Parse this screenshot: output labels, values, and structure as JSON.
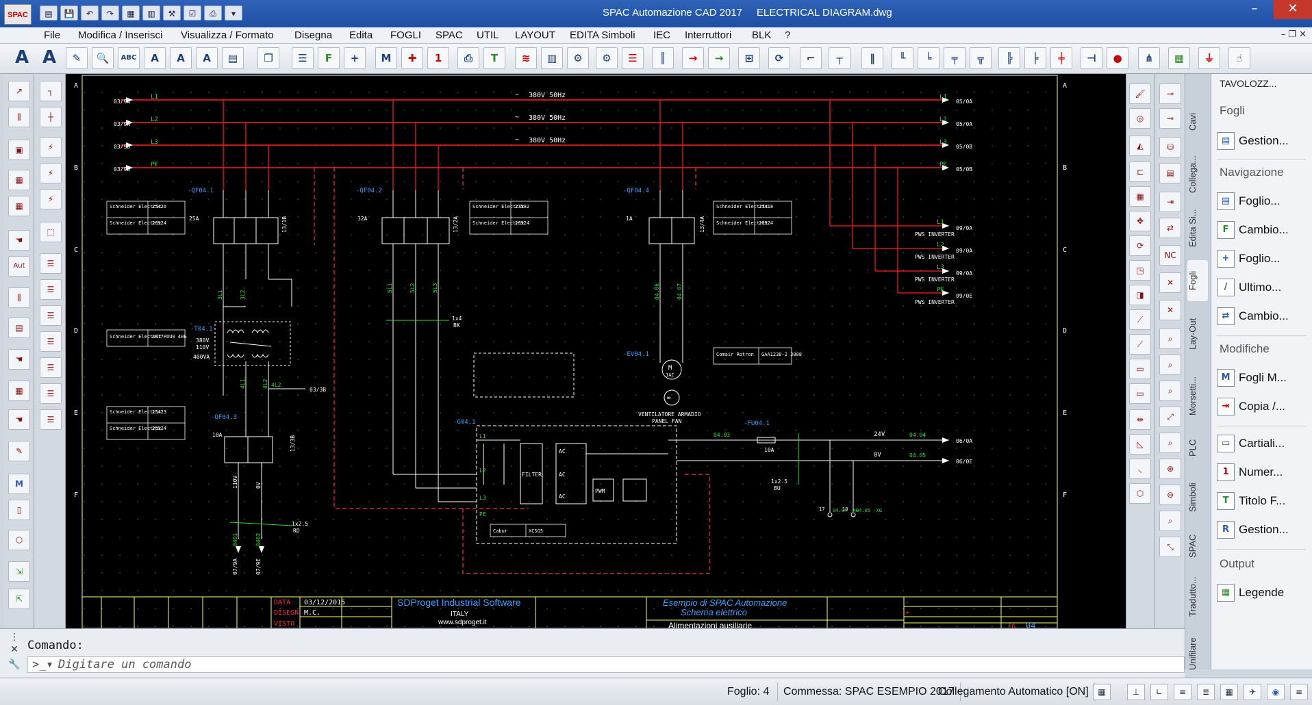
{
  "window": {
    "app_title": "SPAC Automazione CAD 2017",
    "file_title": "ELECTRICAL DIAGRAM.dwg",
    "logo": "SPAC"
  },
  "menu": [
    "File",
    "Modifica / Inserisci",
    "Visualizza / Formato",
    "Disegna",
    "Edita",
    "FOGLI",
    "SPAC",
    "UTIL",
    "LAYOUT",
    "EDITA Simboli",
    "IEC",
    "Interruttori",
    "BLK",
    "?"
  ],
  "diagram": {
    "rows": [
      "A",
      "B",
      "C",
      "D",
      "E",
      "F"
    ],
    "phases": [
      {
        "src": "03/9A",
        "name": "L1",
        "dst": "05/0A"
      },
      {
        "src": "03/9A",
        "name": "L2",
        "dst": "05/0A"
      },
      {
        "src": "03/9B",
        "name": "L3",
        "dst": "05/0B"
      },
      {
        "src": "03/9B",
        "name": "PE",
        "dst": "05/0B"
      }
    ],
    "supply_labels": [
      "380V 50Hz",
      "380V 50Hz",
      "380V 50Hz"
    ],
    "breakers": [
      {
        "tag": "-QF04.1",
        "rating": "25A",
        "ref": "13/1B"
      },
      {
        "tag": "-QF04.2",
        "rating": "32A",
        "ref": "13/2A"
      },
      {
        "tag": "-QF04.4",
        "rating": "1A",
        "ref": "13/4A"
      },
      {
        "tag": "-QF04.3",
        "rating": "10A",
        "ref": "13/3B"
      }
    ],
    "component_tables": [
      {
        "rows": [
          [
            "Schneider Electric",
            "25426"
          ],
          [
            "Schneider Electric",
            "26924"
          ]
        ]
      },
      {
        "rows": [
          [
            "Schneider Electric",
            "23592"
          ],
          [
            "Schneider Electric",
            "26924"
          ]
        ]
      },
      {
        "rows": [
          [
            "Schneider Electric",
            "25418"
          ],
          [
            "Schneider Electric",
            "26924"
          ]
        ]
      },
      {
        "rows": [
          [
            "Schneider Electric",
            "ABT7PDU0 40G"
          ]
        ]
      },
      {
        "rows": [
          [
            "Schneider Electric",
            "25423"
          ],
          [
            "Schneider Electric",
            "26924"
          ]
        ]
      },
      {
        "rows": [
          [
            "Comair Rotron",
            "GAA1238-2 3088"
          ]
        ]
      },
      {
        "rows": [
          [
            "Cabur",
            "XCSG5"
          ]
        ]
      }
    ],
    "inverter_outputs": [
      {
        "name": "L1",
        "label": "PWS INVERTER",
        "dst": "09/0A"
      },
      {
        "name": "L2",
        "label": "PWS INVERTER",
        "dst": "09/0A"
      },
      {
        "name": "L3",
        "label": "PWS INVERTER",
        "dst": "09/0A"
      },
      {
        "name": "PE",
        "label": "PWS INVERTER",
        "dst": "09/0E"
      }
    ],
    "transformer": {
      "tag": "-T04.1",
      "primary": "380V",
      "mid": "110V",
      "secondary": "400VA"
    },
    "wires": {
      "w1": "3L1",
      "w2": "3L2",
      "w3": "4L1",
      "w4": "4L2",
      "w4ref": "03/3B",
      "w5": "5L1",
      "w6": "5L2",
      "w7": "5L3",
      "w8": "04.06",
      "w9": "04.07",
      "w10": "0401",
      "w11": "0402",
      "v110": "110V",
      "v0": "0V",
      "bus1": "1x4",
      "bus2": "BK",
      "bus3": "1x2.5",
      "bus4": "RD",
      "out1": "07/9A",
      "out2": "07/9E"
    },
    "fan": {
      "tag": "-EV04.1",
      "motor": "M",
      "ac": "1AC",
      "label1": "VENTILATORE ARMADIO",
      "label2": "PANEL FAN"
    },
    "psu": {
      "tag": "-G04.1",
      "filter": "FILTER",
      "pwm": "PWM",
      "ac": "AC",
      "dc": "DC"
    },
    "fuse": {
      "tag": "-FU04.1",
      "rating": "10A",
      "wire": "04.03",
      "wire2": "04.04",
      "wire3": "04.05",
      "cable": "1x2.5",
      "cable2": "BU"
    },
    "dc_out": [
      {
        "v": "24V",
        "wire": "04.04",
        "dst": "06/0A"
      },
      {
        "v": "0V",
        "wire": "04.05",
        "dst": "06/0E"
      }
    ],
    "terminals": [
      {
        "num": "17",
        "label": "04.04 -XG"
      },
      {
        "num": "18",
        "label": "04.05 -XG"
      }
    ]
  },
  "title_block": {
    "data_label": "DATA",
    "data_value": "03/12/2015",
    "disegn_label": "DISEGN",
    "disegn_value": "M.C.",
    "visto_label": "VISTO",
    "company": "SDProget Industrial Software",
    "country": "ITALY",
    "website": "www.sdproget.it",
    "project1": "Esempio di SPAC Automazione",
    "project2": "Schema elettrico",
    "sheet_title": "Alimentazioni ausiliarie",
    "fg_label": "FG",
    "page": "04"
  },
  "command": {
    "label": "Comando:",
    "placeholder": "Digitare un comando"
  },
  "status": {
    "sheet": "Foglio:  4",
    "job": "Commessa: SPAC ESEMPIO 2017",
    "autolink": "Collegamento Automatico [ON]"
  },
  "palette": {
    "title": "TAVOLOZZ...",
    "sections": [
      {
        "name": "Fogli",
        "items": [
          "Gestion..."
        ]
      },
      {
        "name": "Navigazione",
        "items": [
          "Foglio...",
          "Cambio...",
          "Foglio...",
          "Ultimo...",
          "Cambio..."
        ]
      },
      {
        "name": "Modifiche",
        "items": [
          "Fogli M...",
          "Copia /...",
          "Cartiali...",
          "Numer...",
          "Titolo F...",
          "Gestion..."
        ]
      },
      {
        "name": "Output",
        "items": [
          "Legende"
        ]
      }
    ]
  },
  "vtabs": [
    "Cavi",
    "Collega...",
    "Edita Si...",
    "Fogli",
    "Lay-Out",
    "Morsetti...",
    "PLC",
    "Simboli",
    "SPAC",
    "Tradutto...",
    "Unifilare"
  ],
  "colors": {
    "canvas": "#000000",
    "phase": "#ff2020",
    "wire": "#ffffff",
    "ground": "#22cc22",
    "text_green": "#33dd33",
    "title_blue": "#3aa0ff",
    "pe_dash": "#ff3030"
  }
}
